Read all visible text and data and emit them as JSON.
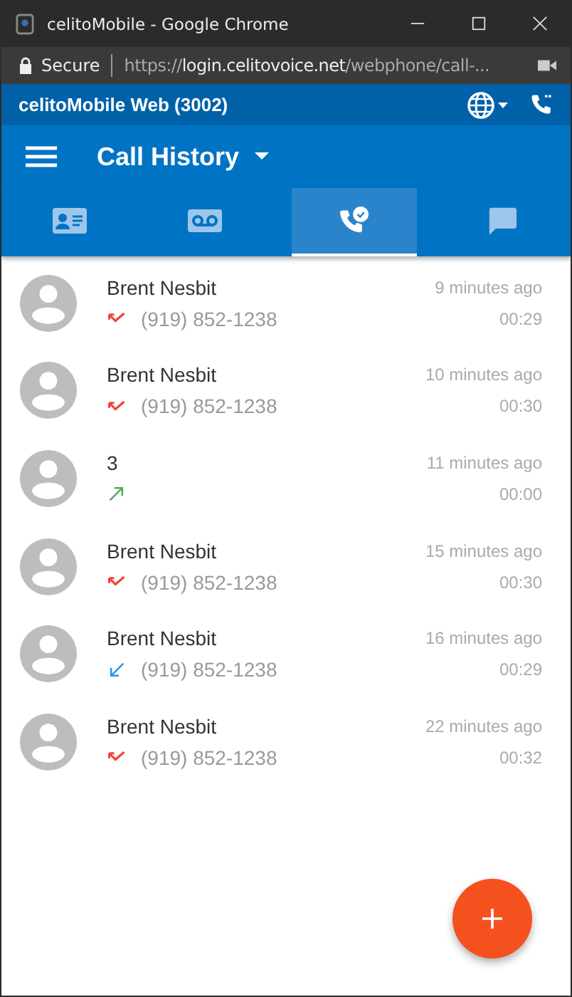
{
  "window": {
    "title": "celitoMobile - Google Chrome"
  },
  "address_bar": {
    "security": "Secure",
    "url_scheme": "https://",
    "url_host": "login.celitovoice.net",
    "url_path": "/webphone/call-..."
  },
  "app_bar": {
    "title": "celitoMobile Web (3002)"
  },
  "toolbar": {
    "title": "Call History"
  },
  "tabs": [
    {
      "kind": "contacts",
      "selected": false
    },
    {
      "kind": "voicemail",
      "selected": false
    },
    {
      "kind": "history",
      "selected": true
    },
    {
      "kind": "chat",
      "selected": false
    }
  ],
  "calls": [
    {
      "name": "Brent Nesbit",
      "number": "(919) 852-1238",
      "kind": "missed",
      "time": "9 minutes ago",
      "duration": "00:29"
    },
    {
      "name": "Brent Nesbit",
      "number": "(919) 852-1238",
      "kind": "missed",
      "time": "10 minutes ago",
      "duration": "00:30"
    },
    {
      "name": "3",
      "kind": "outgoing",
      "time": "11 minutes ago",
      "duration": "00:00"
    },
    {
      "name": "Brent Nesbit",
      "number": "(919) 852-1238",
      "kind": "missed",
      "time": "15 minutes ago",
      "duration": "00:30"
    },
    {
      "name": "Brent Nesbit",
      "number": "(919) 852-1238",
      "kind": "incoming",
      "time": "16 minutes ago",
      "duration": "00:29"
    },
    {
      "name": "Brent Nesbit",
      "number": "(919) 852-1238",
      "kind": "missed",
      "time": "22 minutes ago",
      "duration": "00:32"
    }
  ]
}
